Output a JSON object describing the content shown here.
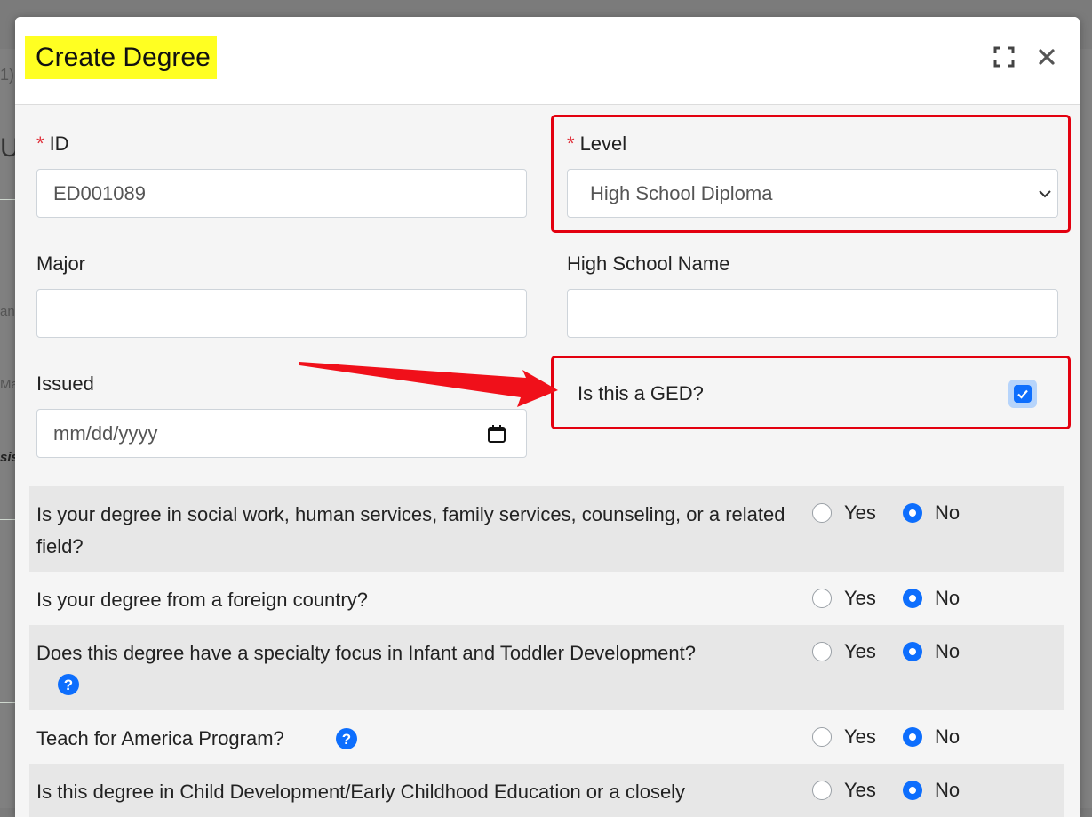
{
  "background": {
    "fragments": [
      "1)",
      "U",
      "anc",
      "Ma",
      "sis"
    ]
  },
  "modal": {
    "title": "Create Degree"
  },
  "form": {
    "id": {
      "label": "ID",
      "value": "ED001089"
    },
    "level": {
      "label": "Level",
      "selected": "High School Diploma"
    },
    "major": {
      "label": "Major",
      "value": ""
    },
    "high_school_name": {
      "label": "High School Name",
      "value": ""
    },
    "issued": {
      "label": "Issued",
      "placeholder": "mm/dd/yyyy"
    },
    "ged": {
      "label": "Is this a GED?",
      "checked": true
    }
  },
  "questions": [
    {
      "text": "Is your degree in social work, human services, family services, counseling, or a related field?",
      "yes": "Yes",
      "no": "No",
      "answer": "No"
    },
    {
      "text": "Is your degree from a foreign country?",
      "yes": "Yes",
      "no": "No",
      "answer": "No"
    },
    {
      "text": "Does this degree have a specialty focus in Infant and Toddler Development?",
      "yes": "Yes",
      "no": "No",
      "answer": "No",
      "help": true
    },
    {
      "text": "Teach for America Program?",
      "yes": "Yes",
      "no": "No",
      "answer": "No",
      "help": true
    },
    {
      "text": "Is this degree in Child Development/Early Childhood Education or a closely",
      "yes": "Yes",
      "no": "No",
      "answer": "No"
    }
  ],
  "annotations": {
    "highlight_color": "#e3000f",
    "arrow_color": "#f0101a"
  },
  "colors": {
    "accent": "#0d6efd",
    "title_highlight": "#ffff22"
  }
}
